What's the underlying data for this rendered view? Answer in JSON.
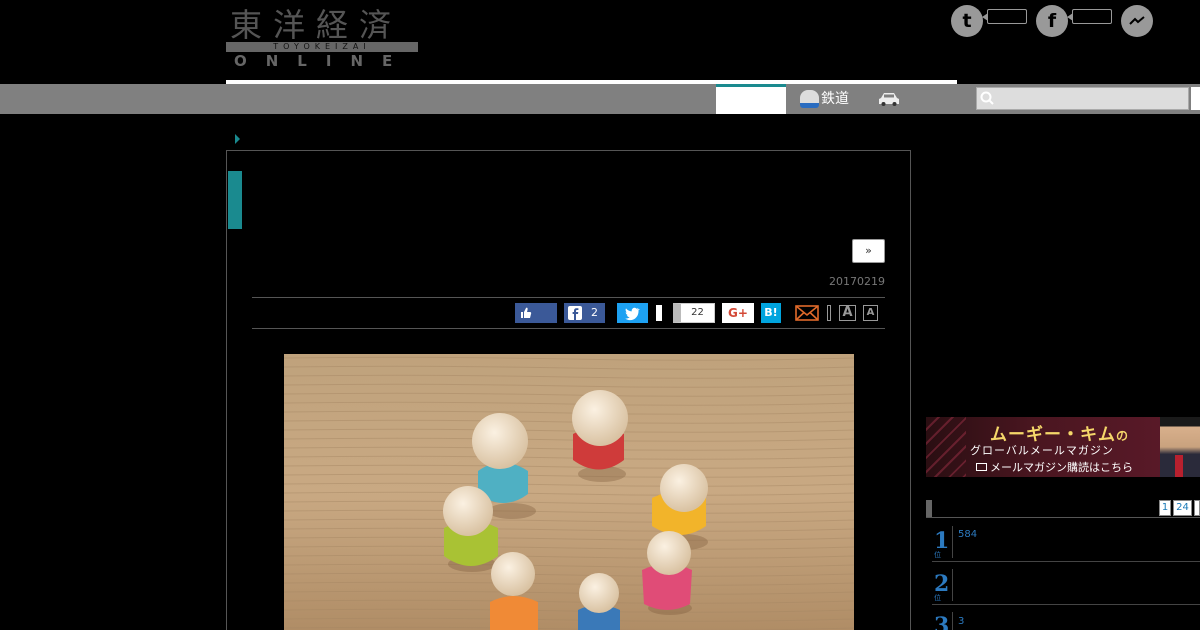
{
  "header": {
    "logo_kanji": "東洋経済",
    "logo_band": "TOYOKEIZAI",
    "logo_online": "ONLINE"
  },
  "social_top": [
    {
      "icon": "twitter-icon",
      "glyph": "t"
    },
    {
      "icon": "facebook-icon",
      "glyph": "f"
    },
    {
      "icon": "messenger-icon",
      "glyph": "~"
    }
  ],
  "nav": {
    "items": [
      {
        "label": "鉄道",
        "icon": "train-icon"
      },
      {
        "label": "",
        "icon": "car-icon"
      }
    ],
    "search_placeholder": ""
  },
  "article": {
    "next_label": "»",
    "date": "20170219",
    "share": {
      "facebook_share_count": "2",
      "hatena_share_count": "22",
      "googleplus_label": "G+",
      "hatena_label": "B!",
      "font_large": "A",
      "font_small": "A"
    },
    "image_icon": "wooden-peg-dolls-photo"
  },
  "sidebar": {
    "banner": {
      "title_main": "ムーギー・キム",
      "title_suffix": "の",
      "subtitle": "グローバルメールマガジン",
      "cta": "メールマガジン購読はこちら"
    },
    "ranking": {
      "tabs": [
        "1",
        "24"
      ],
      "rows": [
        {
          "rank": "1",
          "text": "584"
        },
        {
          "rank": "2",
          "text": ""
        },
        {
          "rank": "3",
          "text": "3"
        }
      ],
      "rank_suffix": "位"
    }
  },
  "colors": {
    "accent_teal": "#1a8a8f",
    "nav_gray": "#808080",
    "facebook": "#3b5998",
    "twitter": "#1da1f2",
    "hatena": "#00a4de",
    "rank_blue": "#2c7ac0"
  }
}
